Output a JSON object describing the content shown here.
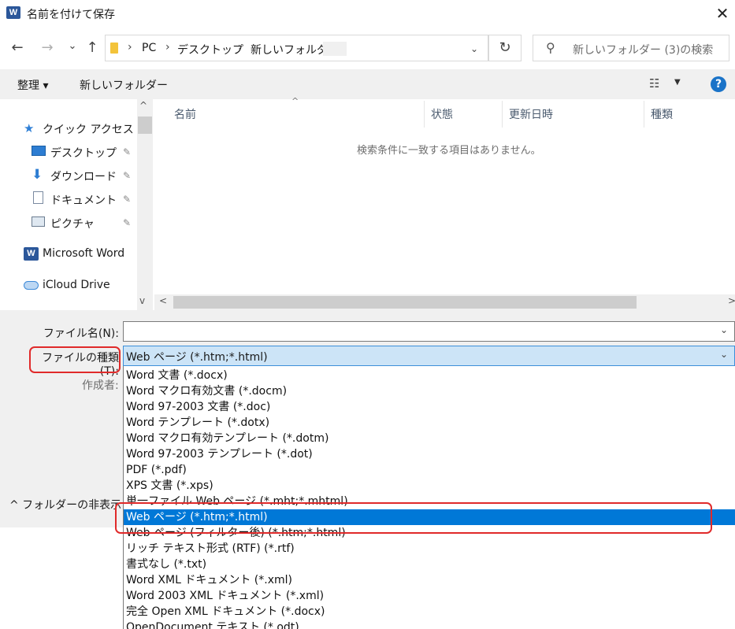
{
  "window": {
    "title": "名前を付けて保存",
    "app_icon_letter": "W",
    "close_glyph": "✕"
  },
  "nav": {
    "back": "←",
    "forward": "→",
    "recent": "⌄",
    "up": "↑",
    "sep": "›",
    "breadcrumb": [
      "PC",
      "デスクトップ",
      "新しいフォルダー"
    ],
    "dropdown": "⌄",
    "refresh": "↻",
    "search_placeholder": "新しいフォルダー (3)の検索",
    "search_glyph": "⚲"
  },
  "toolbar": {
    "organize": "整理 ▾",
    "new_folder": "新しいフォルダー",
    "view_glyph": "☷",
    "view_dd": "▼",
    "help": "?"
  },
  "sidebar": {
    "quick_access": "クイック アクセス",
    "items": [
      {
        "label": "デスクトップ"
      },
      {
        "label": "ダウンロード"
      },
      {
        "label": "ドキュメント"
      },
      {
        "label": "ピクチャ"
      }
    ],
    "word": "Microsoft Word",
    "icloud": "iCloud Drive",
    "scroll_up": "^",
    "scroll_down": "v",
    "pin_glyph": "📌"
  },
  "filelist": {
    "columns": [
      "名前",
      "状態",
      "更新日時",
      "種類"
    ],
    "sort_glyph": "^",
    "empty_message": "検索条件に一致する項目はありません。",
    "scroll_left": "<",
    "scroll_right": ">"
  },
  "form": {
    "filename_label": "ファイル名(N):",
    "filetype_label": "ファイルの種類(T):",
    "filetype_value": "Web ページ (*.htm;*.html)",
    "author_label": "作成者:",
    "hide_folders": "^ フォルダーの非表示",
    "dd_glyph": "⌄"
  },
  "filetype_options": [
    "Word 文書 (*.docx)",
    "Word マクロ有効文書 (*.docm)",
    "Word 97-2003 文書 (*.doc)",
    "Word テンプレート (*.dotx)",
    "Word マクロ有効テンプレート (*.dotm)",
    "Word 97-2003 テンプレート (*.dot)",
    "PDF (*.pdf)",
    "XPS 文書 (*.xps)",
    "単一ファイル Web ページ (*.mht;*.mhtml)",
    "Web ページ (*.htm;*.html)",
    "Web ページ (フィルター後) (*.htm;*.html)",
    "リッチ テキスト形式 (RTF) (*.rtf)",
    "書式なし (*.txt)",
    "Word XML ドキュメント (*.xml)",
    "Word 2003 XML ドキュメント (*.xml)",
    "完全 Open XML ドキュメント (*.docx)",
    "OpenDocument テキスト (*.odt)"
  ],
  "selected_option_index": 9,
  "colors": {
    "accent": "#0078d7",
    "highlight_red": "#e02a2a",
    "word_blue": "#2b579a"
  }
}
